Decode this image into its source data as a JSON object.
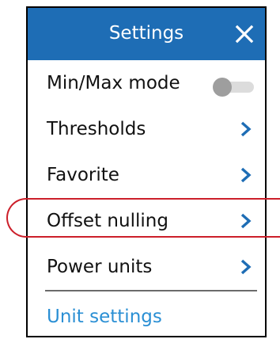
{
  "header": {
    "title": "Settings",
    "close_icon": "close-icon"
  },
  "menu": {
    "items": [
      {
        "label": "Min/Max mode",
        "control": "toggle",
        "state": "off"
      },
      {
        "label": "Thresholds",
        "control": "chevron-right-icon"
      },
      {
        "label": "Favorite",
        "control": "chevron-right-icon"
      },
      {
        "label": "Offset nulling",
        "control": "chevron-right-icon"
      },
      {
        "label": "Power units",
        "control": "chevron-right-icon"
      }
    ],
    "link": "Unit settings"
  },
  "colors": {
    "header_bg": "#1e6db5",
    "accent": "#1e6db5",
    "link": "#2a8fd4",
    "highlight": "#cc1f2a"
  }
}
